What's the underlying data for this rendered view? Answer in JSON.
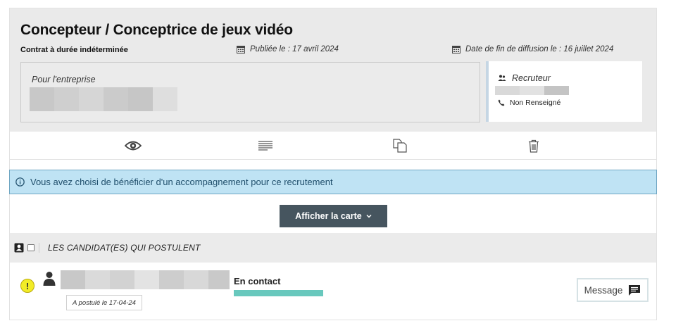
{
  "job": {
    "title": "Concepteur / Conceptrice de jeux vidéo",
    "contract": "Contrat à durée indéterminée",
    "published": "Publiée le : 17 avril 2024",
    "end_date": "Date de fin de diffusion le : 16 juillet 2024"
  },
  "company": {
    "label": "Pour l'entreprise"
  },
  "recruiter": {
    "title": "Recruteur",
    "phone": "Non Renseigné"
  },
  "toolbar": {
    "icons": [
      "eye-icon",
      "lines-icon",
      "duplicate-icon",
      "trash-icon"
    ]
  },
  "banner": {
    "text": "Vous avez choisi de bénéficier d'un accompagnement pour ce recrutement"
  },
  "map_button": {
    "label": "Afficher la carte"
  },
  "candidates": {
    "title": "LES CANDIDAT(ES) QUI POSTULENT",
    "items": [
      {
        "applied": "A postulé le 17-04-24",
        "status": "En contact",
        "message_label": "Message"
      }
    ]
  },
  "colors": {
    "header_bg": "#eaeaea",
    "banner_bg": "#bfe3f4",
    "map_button_bg": "#46555f",
    "status_bar": "#68c8bd",
    "warning": "#f2ec27"
  }
}
